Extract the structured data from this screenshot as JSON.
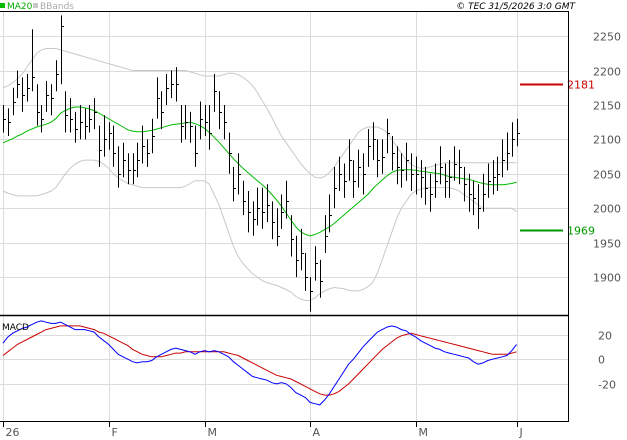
{
  "header": {
    "legend_ma": "MA20",
    "legend_bb": "BBands",
    "copyright": "© TEC 31/5/2026 3:0 GMT"
  },
  "colors": {
    "price_bar": "#000000",
    "ma": "#00bb00",
    "bbands": "#c8c8c8",
    "macd": "#0000ff",
    "signal": "#cc0000",
    "resistance": "#cc0000",
    "support": "#009900",
    "grid": "#dcdcdc",
    "frame": "#000000"
  },
  "chart_data": [
    {
      "type": "ohlc",
      "panel": "price",
      "ylim": [
        1845,
        2285
      ],
      "yticks": [
        1900,
        1950,
        2000,
        2050,
        2100,
        2150,
        2200,
        2250
      ],
      "ytick_labels": [
        "1900",
        "1950",
        "2000",
        "2050",
        "2100",
        "2150",
        "2200",
        "2250"
      ],
      "xtick_labels": [
        "26",
        "F",
        "M",
        "A",
        "M",
        "J"
      ],
      "xtick_index": [
        0,
        22,
        42,
        64,
        86,
        107
      ],
      "series": [
        {
          "name": "Price",
          "close": [
            2130,
            2125,
            2155,
            2180,
            2165,
            2175,
            2190,
            2140,
            2130,
            2165,
            2160,
            2195,
            2265,
            2135,
            2130,
            2115,
            2125,
            2120,
            2130,
            2140,
            2085,
            2100,
            2110,
            2080,
            2050,
            2070,
            2055,
            2055,
            2070,
            2090,
            2080,
            2105,
            2160,
            2140,
            2175,
            2180,
            2180,
            2120,
            2125,
            2120,
            2080,
            2130,
            2125,
            2110,
            2170,
            2140,
            2125,
            2080,
            2030,
            2050,
            2010,
            1995,
            1985,
            2000,
            1995,
            2005,
            1980,
            1960,
            1995,
            2010,
            1955,
            1925,
            1935,
            1900,
            1880,
            1920,
            1895,
            1960,
            1990,
            2030,
            2050,
            2040,
            2070,
            2040,
            2060,
            2050,
            2090,
            2100,
            2070,
            2075,
            2110,
            2080,
            2060,
            2055,
            2070,
            2050,
            2050,
            2045,
            2030,
            2020,
            2040,
            2060,
            2040,
            2045,
            2065,
            2060,
            2035,
            2020,
            2015,
            2000,
            2020,
            2040,
            2045,
            2050,
            2070,
            2080,
            2100,
            2110
          ],
          "high": [
            2150,
            2145,
            2175,
            2200,
            2190,
            2195,
            2260,
            2180,
            2150,
            2185,
            2180,
            2215,
            2280,
            2170,
            2160,
            2140,
            2150,
            2145,
            2150,
            2160,
            2120,
            2135,
            2125,
            2120,
            2090,
            2095,
            2080,
            2080,
            2095,
            2120,
            2100,
            2130,
            2190,
            2170,
            2195,
            2200,
            2205,
            2150,
            2150,
            2140,
            2120,
            2155,
            2150,
            2150,
            2195,
            2170,
            2150,
            2110,
            2060,
            2080,
            2040,
            2025,
            2010,
            2030,
            2030,
            2035,
            2010,
            2000,
            2020,
            2040,
            1990,
            1960,
            1970,
            1935,
            1900,
            1945,
            1925,
            1990,
            2020,
            2060,
            2075,
            2065,
            2100,
            2070,
            2085,
            2080,
            2115,
            2125,
            2100,
            2100,
            2130,
            2105,
            2090,
            2080,
            2095,
            2080,
            2075,
            2070,
            2060,
            2050,
            2065,
            2090,
            2065,
            2070,
            2090,
            2085,
            2060,
            2050,
            2040,
            2035,
            2050,
            2065,
            2070,
            2075,
            2100,
            2110,
            2125,
            2130
          ],
          "low": [
            2110,
            2105,
            2135,
            2160,
            2140,
            2155,
            2170,
            2120,
            2110,
            2140,
            2135,
            2170,
            2180,
            2110,
            2110,
            2095,
            2100,
            2100,
            2110,
            2115,
            2060,
            2075,
            2085,
            2060,
            2030,
            2045,
            2035,
            2035,
            2045,
            2065,
            2060,
            2080,
            2130,
            2115,
            2150,
            2160,
            2155,
            2095,
            2100,
            2095,
            2060,
            2100,
            2105,
            2085,
            2140,
            2115,
            2100,
            2050,
            2010,
            2020,
            1990,
            1965,
            1960,
            1975,
            1970,
            1980,
            1955,
            1945,
            1970,
            1985,
            1930,
            1900,
            1910,
            1880,
            1850,
            1895,
            1870,
            1935,
            1965,
            2000,
            2025,
            2015,
            2040,
            2015,
            2030,
            2020,
            2060,
            2070,
            2045,
            2050,
            2080,
            2055,
            2035,
            2030,
            2040,
            2025,
            2020,
            2015,
            2005,
            1995,
            2015,
            2035,
            2015,
            2015,
            2040,
            2035,
            2010,
            1995,
            1990,
            1970,
            1995,
            2015,
            2020,
            2025,
            2045,
            2055,
            2075,
            2090
          ]
        },
        {
          "name": "MA20",
          "values": [
            2095,
            2098,
            2101,
            2105,
            2108,
            2112,
            2115,
            2118,
            2120,
            2122,
            2125,
            2130,
            2138,
            2142,
            2145,
            2147,
            2147,
            2146,
            2144,
            2142,
            2138,
            2134,
            2130,
            2126,
            2122,
            2118,
            2114,
            2112,
            2111,
            2111,
            2112,
            2113,
            2115,
            2117,
            2119,
            2121,
            2122,
            2123,
            2124,
            2125,
            2123,
            2120,
            2116,
            2110,
            2103,
            2096,
            2088,
            2080,
            2072,
            2065,
            2058,
            2052,
            2046,
            2040,
            2034,
            2028,
            2020,
            2012,
            2003,
            1993,
            1983,
            1973,
            1966,
            1962,
            1960,
            1962,
            1965,
            1969,
            1973,
            1978,
            1984,
            1990,
            1996,
            2002,
            2008,
            2014,
            2020,
            2028,
            2035,
            2041,
            2047,
            2052,
            2055,
            2056,
            2056,
            2056,
            2055,
            2054,
            2053,
            2052,
            2051,
            2050,
            2048,
            2046,
            2045,
            2044,
            2043,
            2042,
            2040,
            2038,
            2036,
            2035,
            2034,
            2034,
            2034,
            2035,
            2036,
            2038
          ]
        },
        {
          "name": "BBands",
          "upper": [
            2175,
            2178,
            2182,
            2188,
            2195,
            2205,
            2215,
            2225,
            2230,
            2232,
            2232,
            2232,
            2230,
            2228,
            2226,
            2224,
            2222,
            2220,
            2218,
            2216,
            2214,
            2212,
            2210,
            2208,
            2206,
            2204,
            2202,
            2200,
            2200,
            2200,
            2200,
            2200,
            2200,
            2200,
            2200,
            2200,
            2200,
            2200,
            2200,
            2198,
            2196,
            2194,
            2192,
            2192,
            2192,
            2192,
            2194,
            2196,
            2196,
            2194,
            2190,
            2185,
            2178,
            2168,
            2156,
            2145,
            2132,
            2118,
            2105,
            2095,
            2085,
            2075,
            2065,
            2057,
            2050,
            2045,
            2044,
            2046,
            2052,
            2060,
            2070,
            2080,
            2090,
            2100,
            2110,
            2115,
            2118,
            2118,
            2118,
            2115,
            2110,
            2100,
            2090,
            2080,
            2070,
            2064,
            2060,
            2058,
            2058,
            2060,
            2062,
            2064,
            2066,
            2066,
            2066,
            2066,
            2066,
            2066,
            2066,
            2066,
            2066,
            2066,
            2066,
            2066,
            2066,
            2066,
            2066,
            2066
          ],
          "lower": [
            2025,
            2022,
            2020,
            2018,
            2018,
            2018,
            2018,
            2018,
            2020,
            2022,
            2025,
            2030,
            2040,
            2050,
            2058,
            2064,
            2068,
            2070,
            2070,
            2070,
            2068,
            2064,
            2058,
            2050,
            2044,
            2040,
            2036,
            2034,
            2032,
            2030,
            2030,
            2030,
            2030,
            2030,
            2030,
            2030,
            2030,
            2030,
            2032,
            2036,
            2040,
            2040,
            2040,
            2035,
            2020,
            2005,
            1985,
            1965,
            1945,
            1930,
            1920,
            1912,
            1905,
            1900,
            1895,
            1892,
            1890,
            1888,
            1885,
            1882,
            1878,
            1872,
            1868,
            1866,
            1866,
            1870,
            1876,
            1880,
            1883,
            1885,
            1884,
            1883,
            1881,
            1880,
            1880,
            1882,
            1886,
            1892,
            1906,
            1925,
            1945,
            1965,
            1985,
            2000,
            2010,
            2020,
            2025,
            2028,
            2030,
            2030,
            2030,
            2030,
            2030,
            2030,
            2028,
            2025,
            2020,
            2015,
            2010,
            2005,
            2000,
            2000,
            2000,
            2000,
            2000,
            2000,
            2000,
            1995
          ]
        }
      ],
      "annotations": [
        {
          "label": "2181",
          "value": 2181,
          "color": "#cc0000"
        },
        {
          "label": "1969",
          "value": 1969,
          "color": "#009900"
        }
      ]
    },
    {
      "type": "line",
      "panel": "macd",
      "title": "MACD",
      "ylim": [
        -50,
        35
      ],
      "yticks": [
        -20,
        0,
        20
      ],
      "ytick_labels": [
        "-20",
        "0",
        "20"
      ],
      "series": [
        {
          "name": "MACD",
          "values": [
            13,
            18,
            21,
            23,
            25,
            26,
            28,
            30,
            31,
            30,
            29,
            29,
            30,
            28,
            26,
            24,
            24,
            24,
            23,
            22,
            18,
            15,
            12,
            8,
            4,
            2,
            0,
            -2,
            -3,
            -2,
            -2,
            -1,
            2,
            4,
            6,
            8,
            9,
            8,
            7,
            6,
            4,
            6,
            7,
            6,
            7,
            6,
            4,
            2,
            -2,
            -5,
            -8,
            -11,
            -14,
            -15,
            -16,
            -17,
            -19,
            -20,
            -19,
            -20,
            -23,
            -27,
            -29,
            -31,
            -35,
            -36,
            -37,
            -33,
            -28,
            -22,
            -16,
            -10,
            -4,
            0,
            5,
            10,
            14,
            18,
            22,
            24,
            26,
            27,
            26,
            24,
            23,
            20,
            18,
            15,
            13,
            11,
            9,
            8,
            6,
            5,
            4,
            3,
            2,
            1,
            -2,
            -4,
            -3,
            -1,
            0,
            1,
            2,
            3,
            7,
            12
          ]
        },
        {
          "name": "Signal",
          "values": [
            3,
            6,
            9,
            12,
            14,
            16,
            18,
            20,
            22,
            24,
            25,
            26,
            27,
            27,
            27,
            27,
            27,
            26,
            25,
            24,
            22,
            21,
            19,
            17,
            15,
            13,
            11,
            8,
            6,
            4,
            3,
            2,
            2,
            2,
            3,
            4,
            5,
            5,
            6,
            6,
            6,
            6,
            6,
            6,
            6,
            6,
            6,
            5,
            4,
            3,
            1,
            -1,
            -3,
            -5,
            -7,
            -9,
            -11,
            -13,
            -14,
            -15,
            -16,
            -18,
            -20,
            -22,
            -24,
            -26,
            -28,
            -29,
            -29,
            -28,
            -26,
            -23,
            -20,
            -16,
            -12,
            -8,
            -4,
            0,
            4,
            8,
            11,
            14,
            17,
            19,
            20,
            21,
            20,
            19,
            18,
            17,
            16,
            15,
            14,
            13,
            12,
            11,
            10,
            9,
            8,
            7,
            6,
            5,
            4,
            4,
            4,
            4,
            5,
            6
          ]
        }
      ]
    }
  ]
}
